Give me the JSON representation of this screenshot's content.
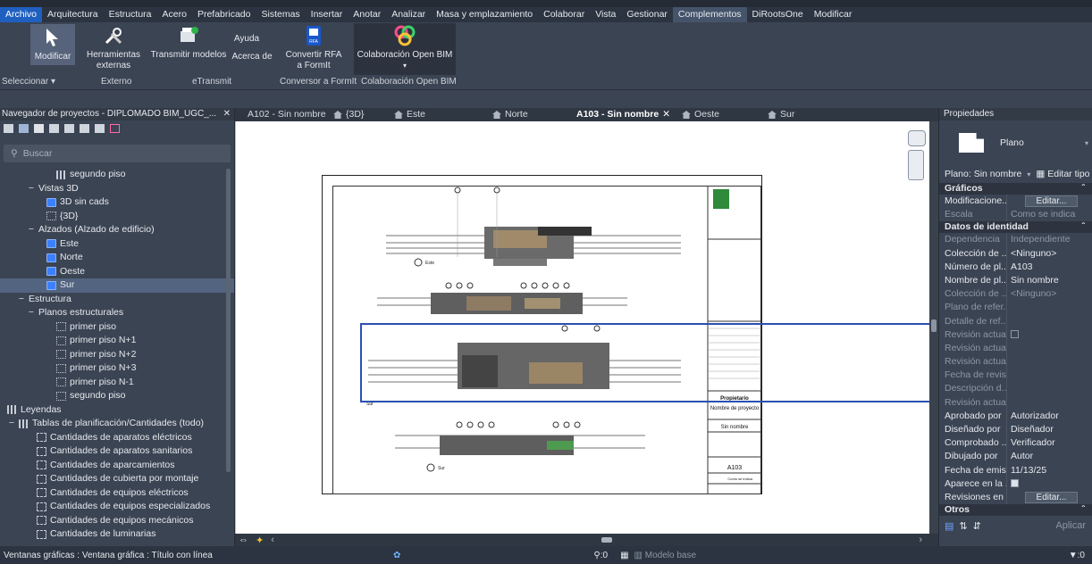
{
  "colors": {
    "accent": "#1f5fbf",
    "panel": "#3b4453",
    "selection_box": "#2c4fb2"
  },
  "menu": [
    "Archivo",
    "Arquitectura",
    "Estructura",
    "Acero",
    "Prefabricado",
    "Sistemas",
    "Insertar",
    "Anotar",
    "Analizar",
    "Masa y emplazamiento",
    "Colaborar",
    "Vista",
    "Gestionar",
    "Complementos",
    "DiRootsOne",
    "Modificar"
  ],
  "ribbon": {
    "modify": "Modificar",
    "ext_tools_1": "Herramientas",
    "ext_tools_2": "externas",
    "transmit": "Transmitir modelos",
    "help": "Ayuda",
    "about": "Acerca de",
    "rfa_1": "Convertir RFA",
    "rfa_2": "a FormIt",
    "obim": "Colaboración Open BIM",
    "rfa_badge": "RFA",
    "panel_select": "Seleccionar",
    "panel_external": "Externo",
    "panel_etransmit": "eTransmit",
    "panel_formit": "Conversor a FormIt",
    "panel_obim": "Colaboración Open BIM"
  },
  "browser": {
    "title": "Navegador de proyectos - DIPLOMADO BIM_UGC_...",
    "search_placeholder": "Buscar",
    "items": [
      {
        "label": "segundo piso",
        "level": 5,
        "ico": "grid"
      },
      {
        "label": "Vistas 3D",
        "level": 2,
        "toggle": "−"
      },
      {
        "label": "3D sin cads",
        "level": 4,
        "ico": "blue"
      },
      {
        "label": "{3D}",
        "level": 4,
        "ico": "view"
      },
      {
        "label": "Alzados (Alzado de edificio)",
        "level": 2,
        "toggle": "−"
      },
      {
        "label": "Este",
        "level": 4,
        "ico": "blue"
      },
      {
        "label": "Norte",
        "level": 4,
        "ico": "blue"
      },
      {
        "label": "Oeste",
        "level": 4,
        "ico": "blue"
      },
      {
        "label": "Sur",
        "level": 4,
        "ico": "blue",
        "sel": true
      },
      {
        "label": "Estructura",
        "level": 1,
        "toggle": "−"
      },
      {
        "label": "Planos estructurales",
        "level": 2,
        "toggle": "−"
      },
      {
        "label": "primer piso",
        "level": 5,
        "ico": "view"
      },
      {
        "label": "primer piso N+1",
        "level": 5,
        "ico": "view"
      },
      {
        "label": "primer piso N+2",
        "level": 5,
        "ico": "view"
      },
      {
        "label": "primer piso N+3",
        "level": 5,
        "ico": "view"
      },
      {
        "label": "primer piso N-1",
        "level": 5,
        "ico": "view"
      },
      {
        "label": "segundo piso",
        "level": 5,
        "ico": "view"
      },
      {
        "label": "Leyendas",
        "level": 0,
        "ico": "grid"
      },
      {
        "label": "Tablas de planificación/Cantidades (todo)",
        "level": 0,
        "toggle": "−",
        "ico": "grid"
      },
      {
        "label": "Cantidades de aparatos eléctricos",
        "level": 3,
        "ico": "sched"
      },
      {
        "label": "Cantidades de aparatos sanitarios",
        "level": 3,
        "ico": "sched"
      },
      {
        "label": "Cantidades de aparcamientos",
        "level": 3,
        "ico": "sched"
      },
      {
        "label": "Cantidades de cubierta por montaje",
        "level": 3,
        "ico": "sched"
      },
      {
        "label": "Cantidades de equipos eléctricos",
        "level": 3,
        "ico": "sched"
      },
      {
        "label": "Cantidades de equipos especializados",
        "level": 3,
        "ico": "sched"
      },
      {
        "label": "Cantidades de equipos mecánicos",
        "level": 3,
        "ico": "sched"
      },
      {
        "label": "Cantidades de luminarias",
        "level": 3,
        "ico": "sched"
      }
    ]
  },
  "tabs": [
    {
      "label": "A102 - Sin nombre",
      "ico": "sheet"
    },
    {
      "label": "{3D}",
      "ico": "house"
    },
    {
      "label": "Este",
      "ico": "house"
    },
    {
      "label": "Norte",
      "ico": "house"
    },
    {
      "label": "A103 - Sin nombre",
      "ico": "sheet",
      "active": true
    },
    {
      "label": "Oeste",
      "ico": "house"
    },
    {
      "label": "Sur",
      "ico": "house"
    }
  ],
  "sheet": {
    "owner": "Propietario",
    "project_name": "Nombre de proyecto",
    "sin_nombre": "Sin nombre",
    "number": "A103",
    "scale_label": "Como se indica",
    "view_titles": [
      "Este",
      "Norte",
      "Sur"
    ]
  },
  "props": {
    "title": "Propiedades",
    "type": "Plano",
    "selector": "Plano: Sin nombre",
    "edit_type": "Editar tipo",
    "sections": {
      "graficos": "Gráficos",
      "identidad": "Datos de identidad",
      "otros": "Otros"
    },
    "rows_graf": [
      {
        "k": "Modificacione...",
        "v": "Editar...",
        "btn": true
      },
      {
        "k": "Escala",
        "v": "Como se indica",
        "dim": true
      }
    ],
    "rows_id": [
      {
        "k": "Dependencia",
        "v": "Independiente",
        "dim": true
      },
      {
        "k": "Colección de ...",
        "v": "<Ninguno>"
      },
      {
        "k": "Número de pl...",
        "v": "A103"
      },
      {
        "k": "Nombre de pl...",
        "v": "Sin nombre"
      },
      {
        "k": "Colección de ...",
        "v": "<Ninguno>",
        "dim": true
      },
      {
        "k": "Plano de refer...",
        "v": "",
        "dim": true
      },
      {
        "k": "Detalle de ref...",
        "v": "",
        "dim": true
      },
      {
        "k": "Revisión actua...",
        "v": "",
        "dim": true,
        "chk": "off"
      },
      {
        "k": "Revisión actua...",
        "v": "",
        "dim": true
      },
      {
        "k": "Revisión actua...",
        "v": "",
        "dim": true
      },
      {
        "k": "Fecha de revis...",
        "v": "",
        "dim": true
      },
      {
        "k": "Descripción d...",
        "v": "",
        "dim": true
      },
      {
        "k": "Revisión actual",
        "v": "",
        "dim": true
      },
      {
        "k": "Aprobado por",
        "v": "Autorizador"
      },
      {
        "k": "Diseñado por",
        "v": "Diseñador"
      },
      {
        "k": "Comprobado ...",
        "v": "Verificador"
      },
      {
        "k": "Dibujado por",
        "v": "Autor"
      },
      {
        "k": "Fecha de emis...",
        "v": "11/13/25"
      },
      {
        "k": "Aparece en la ...",
        "v": "",
        "chk": "on"
      },
      {
        "k": "Revisiones en ...",
        "v": "Editar...",
        "btn": true
      }
    ],
    "apply": "Aplicar"
  },
  "status": {
    "left": "Ventanas gráficas : Ventana gráfica : Título con línea",
    "zero1": ":0",
    "model": "Modelo base",
    "zero2": ":0"
  }
}
